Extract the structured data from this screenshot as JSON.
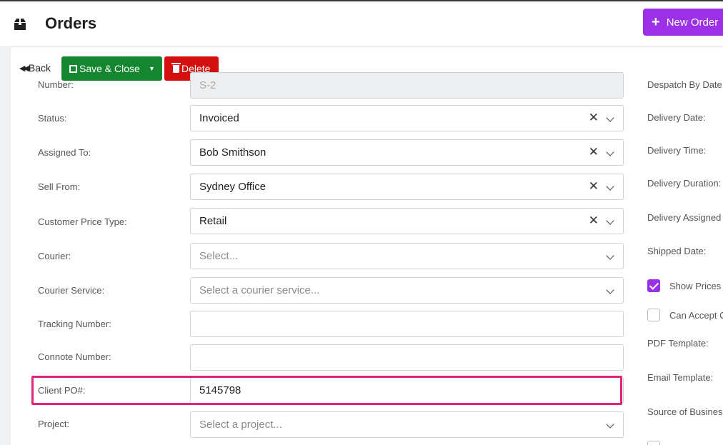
{
  "header": {
    "title": "Orders",
    "new_order_label": "New Order"
  },
  "toolbar": {
    "back_label": "Back",
    "save_close_label": "Save & Close",
    "delete_label": "Delete"
  },
  "form": {
    "number": {
      "label": "Number:",
      "value": "S-2"
    },
    "status": {
      "label": "Status:",
      "value": "Invoiced"
    },
    "assigned_to": {
      "label": "Assigned To:",
      "value": "Bob Smithson"
    },
    "sell_from": {
      "label": "Sell From:",
      "value": "Sydney Office"
    },
    "customer_price_type": {
      "label": "Customer Price Type:",
      "value": "Retail"
    },
    "courier": {
      "label": "Courier:",
      "placeholder": "Select..."
    },
    "courier_service": {
      "label": "Courier Service:",
      "placeholder": "Select a courier service..."
    },
    "tracking_number": {
      "label": "Tracking Number:",
      "value": ""
    },
    "connote_number": {
      "label": "Connote Number:",
      "value": ""
    },
    "client_po": {
      "label": "Client PO#:",
      "value": "5145798"
    },
    "project": {
      "label": "Project:",
      "placeholder": "Select a project..."
    }
  },
  "right_column": {
    "despatch_by_date": "Despatch By Date:",
    "delivery_date": "Delivery Date:",
    "delivery_time": "Delivery Time:",
    "delivery_duration": "Delivery Duration:",
    "delivery_assigned": "Delivery Assigned",
    "shipped_date": "Shipped Date:",
    "show_prices": {
      "label": "Show Prices I",
      "checked": true
    },
    "can_accept": {
      "label": "Can Accept C",
      "checked": false
    },
    "pdf_template": "PDF Template:",
    "email_template": "Email Template:",
    "source_of_business": "Source of Business"
  },
  "colors": {
    "accent": "#9b30e6",
    "save": "#14862f",
    "delete": "#d30f0f",
    "highlight": "#e0247a"
  },
  "icons": {
    "app": "box-icon",
    "back": "double-left-arrow-icon",
    "save": "floppy-disk-icon",
    "delete": "trash-icon"
  }
}
